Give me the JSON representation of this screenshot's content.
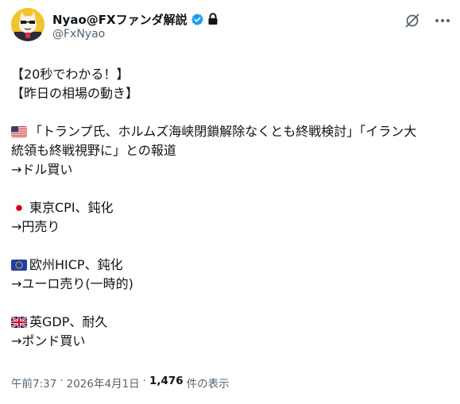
{
  "author": {
    "display_name": "Nyao@FXファンダ解説",
    "handle": "@FxNyao",
    "avatar": "cat-mascot-avatar",
    "verified_icon": "verified-badge-icon",
    "lock_icon": "lock-icon"
  },
  "header_actions": {
    "grok_icon": "grok-icon",
    "more_icon": "more-options-icon"
  },
  "post": {
    "lines": {
      "l1": "【20秒でわかる！】",
      "l2": "【昨日の相場の動き】",
      "us_1": "「トランプ氏、ホルムズ海峡閉鎖解除なくとも終戦検討」「イラン大",
      "us_2": "統領も終戦視野に」との報道",
      "us_3": "→ドル買い",
      "jp_1": "東京CPI、鈍化",
      "jp_2": "→円売り",
      "eu_1": "欧州HICP、鈍化",
      "eu_2": "→ユーロ売り(一時的)",
      "uk_1": "英GDP、耐久",
      "uk_2": "→ポンド買い"
    },
    "flags": {
      "us": "us-flag",
      "jp": "japan-flag",
      "eu": "eu-flag",
      "uk": "uk-flag"
    }
  },
  "meta": {
    "time": "午前7:37",
    "sep1": "·",
    "date": "2026年4月1日",
    "sep2": "·",
    "views": "1,476",
    "views_suffix": "件の表示"
  },
  "colors": {
    "verified": "#1d9bf0",
    "secondary_text": "#536471",
    "primary_text": "#0f1419"
  }
}
